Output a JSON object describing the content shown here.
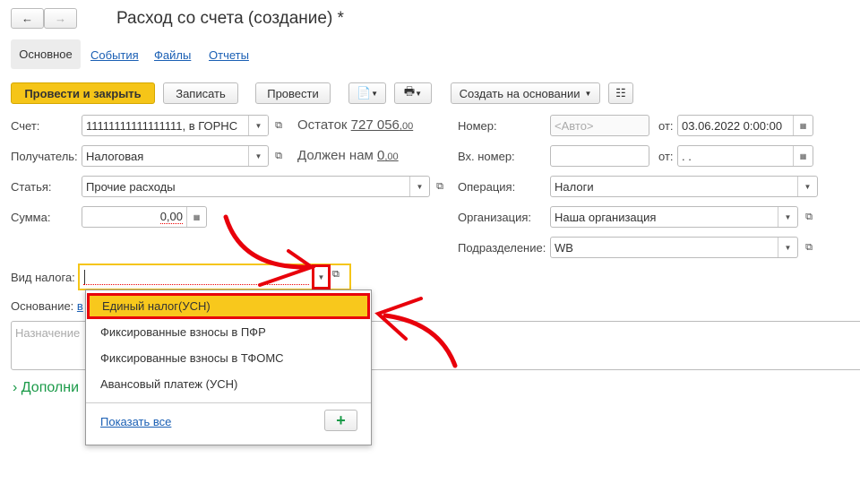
{
  "window": {
    "title": "Расход со счета (создание) *"
  },
  "nav": {
    "back": "←",
    "forward": "→"
  },
  "tabs": [
    {
      "label": "Основное",
      "active": true
    },
    {
      "label": "События"
    },
    {
      "label": "Файлы"
    },
    {
      "label": "Отчеты"
    }
  ],
  "toolbar": {
    "post_close": "Провести и закрыть",
    "save": "Записать",
    "post": "Провести",
    "create_based": "Создать на основании"
  },
  "form": {
    "account_label": "Счет:",
    "account_value": "11111111111111111, в ГОРНС",
    "balance_label": "Остаток",
    "balance_value": "727 056",
    "balance_cents": ",00",
    "recipient_label": "Получатель:",
    "recipient_value": "Налоговая",
    "owes_label": "Должен нам",
    "owes_value": "0",
    "owes_cents": ",00",
    "article_label": "Статья:",
    "article_value": "Прочие расходы",
    "sum_label": "Сумма:",
    "sum_value": "0,00",
    "number_label": "Номер:",
    "number_placeholder": "<Авто>",
    "from_label": "от:",
    "date_value": "03.06.2022  0:00:00",
    "in_number_label": "Вх. номер:",
    "in_date_value": " .  .",
    "operation_label": "Операция:",
    "operation_value": "Налоги",
    "org_label": "Организация:",
    "org_value": "Наша организация",
    "dept_label": "Подразделение:",
    "dept_value": "WB",
    "tax_label": "Вид налога:",
    "tax_value": "",
    "basis_label": "Основание:",
    "basis_link": "в",
    "purpose_placeholder": "Назначение",
    "additional": "Дополни"
  },
  "dropdown": {
    "items": [
      "Единый налог(УСН)",
      "Фиксированные взносы в ПФР",
      "Фиксированные взносы в ТФОМС",
      "Авансовый платеж (УСН)"
    ],
    "selected": 0,
    "show_all": "Показать все",
    "add": "+"
  },
  "colors": {
    "accent": "#f5c518",
    "highlight": "#f8c81c",
    "annotation": "#e8000b",
    "link": "#1a5fb4",
    "green": "#1a9a48"
  }
}
